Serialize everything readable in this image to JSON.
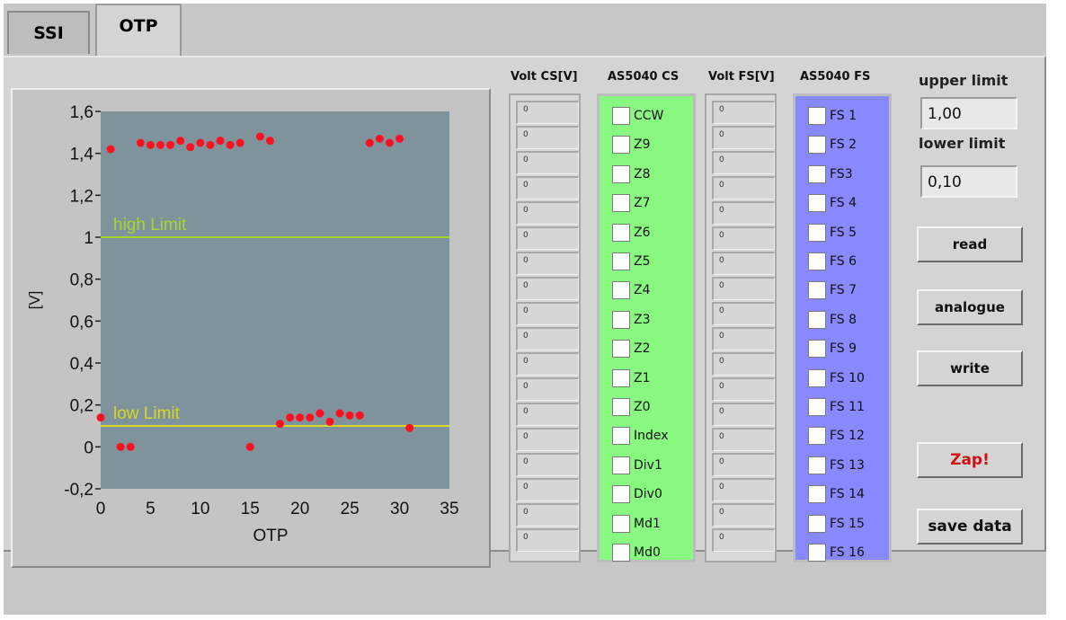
{
  "tabs": [
    {
      "label": "SSI"
    },
    {
      "label": "OTP"
    }
  ],
  "chart_data": {
    "type": "scatter",
    "xlabel": "OTP",
    "ylabel": "[V]",
    "xlim": [
      0,
      35
    ],
    "ylim": [
      -0.2,
      1.6
    ],
    "x_ticks": [
      "0",
      "5",
      "10",
      "15",
      "20",
      "25",
      "30",
      "35"
    ],
    "y_ticks": [
      "1,6",
      "1,4",
      "1,2",
      "1",
      "0,8",
      "0,6",
      "0,4",
      "0,2",
      "0",
      "-0,2"
    ],
    "high_limit": {
      "label": "high Limit",
      "value": 1.0,
      "color": "#a8d830"
    },
    "low_limit": {
      "label": "low Limit",
      "value": 0.1,
      "color": "#d8d820"
    },
    "point_color": "#ff1020",
    "background": "#7e939c",
    "grid": false,
    "points": [
      {
        "x": 0,
        "y": 0.14
      },
      {
        "x": 1,
        "y": 1.42
      },
      {
        "x": 2,
        "y": 0.0
      },
      {
        "x": 3,
        "y": 0.0
      },
      {
        "x": 4,
        "y": 1.45
      },
      {
        "x": 5,
        "y": 1.44
      },
      {
        "x": 6,
        "y": 1.44
      },
      {
        "x": 7,
        "y": 1.44
      },
      {
        "x": 8,
        "y": 1.46
      },
      {
        "x": 9,
        "y": 1.43
      },
      {
        "x": 10,
        "y": 1.45
      },
      {
        "x": 11,
        "y": 1.44
      },
      {
        "x": 12,
        "y": 1.46
      },
      {
        "x": 13,
        "y": 1.44
      },
      {
        "x": 14,
        "y": 1.45
      },
      {
        "x": 15,
        "y": 0.0
      },
      {
        "x": 16,
        "y": 1.48
      },
      {
        "x": 17,
        "y": 1.46
      },
      {
        "x": 18,
        "y": 0.11
      },
      {
        "x": 19,
        "y": 0.14
      },
      {
        "x": 20,
        "y": 0.14
      },
      {
        "x": 21,
        "y": 0.14
      },
      {
        "x": 22,
        "y": 0.16
      },
      {
        "x": 23,
        "y": 0.12
      },
      {
        "x": 24,
        "y": 0.16
      },
      {
        "x": 25,
        "y": 0.15
      },
      {
        "x": 26,
        "y": 0.15
      },
      {
        "x": 27,
        "y": 1.45
      },
      {
        "x": 28,
        "y": 1.47
      },
      {
        "x": 29,
        "y": 1.45
      },
      {
        "x": 30,
        "y": 1.47
      },
      {
        "x": 31,
        "y": 0.09
      }
    ]
  },
  "columns": {
    "volt_cs": {
      "header": "Volt  CS[V]",
      "values": [
        "0",
        "0",
        "0",
        "0",
        "0",
        "0",
        "0",
        "0",
        "0",
        "0",
        "0",
        "0",
        "0",
        "0",
        "0",
        "0",
        "0",
        "0"
      ]
    },
    "as5040_cs": {
      "header": "AS5040 CS",
      "color": "#88f880",
      "items": [
        "CCW",
        "Z9",
        "Z8",
        "Z7",
        "Z6",
        "Z5",
        "Z4",
        "Z3",
        "Z2",
        "Z1",
        "Z0",
        "Index",
        "Div1",
        "Div0",
        "Md1",
        "Md0"
      ]
    },
    "volt_fs": {
      "header": "Volt FS[V]",
      "values": [
        "0",
        "0",
        "0",
        "0",
        "0",
        "0",
        "0",
        "0",
        "0",
        "0",
        "0",
        "0",
        "0",
        "0",
        "0",
        "0",
        "0",
        "0"
      ]
    },
    "as5040_fs": {
      "header": "AS5040 FS",
      "color": "#8888ff",
      "items": [
        "FS 1",
        "FS 2",
        "FS3",
        "FS 4",
        "FS 5",
        "FS 6",
        "FS 7",
        "FS 8",
        "FS 9",
        "FS 10",
        "FS 11",
        "FS 12",
        "FS 13",
        "FS 14",
        "FS 15",
        "FS 16"
      ]
    }
  },
  "controls": {
    "upper_limit_label": "upper limit",
    "upper_limit_value": "1,00",
    "lower_limit_label": "lower limit",
    "lower_limit_value": "0,10",
    "read_label": "read",
    "analogue_label": "analogue",
    "write_label": "write",
    "zap_label": "Zap!",
    "save_label": "save data"
  }
}
